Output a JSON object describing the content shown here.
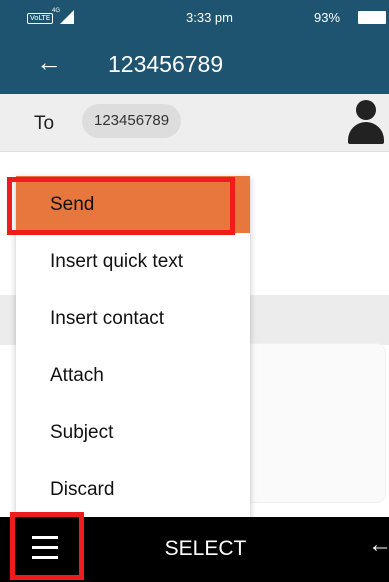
{
  "status_bar": {
    "volte": "VoLTE",
    "network": "4G",
    "time": "3:33 pm",
    "battery": "93%"
  },
  "header": {
    "back_icon": "arrow-left-icon",
    "title": "123456789"
  },
  "recipient": {
    "to_label": "To",
    "chip": "123456789",
    "avatar_icon": "person-icon"
  },
  "menu": {
    "items": [
      {
        "label": "Send",
        "selected": true
      },
      {
        "label": "Insert quick text",
        "selected": false
      },
      {
        "label": "Insert contact",
        "selected": false
      },
      {
        "label": "Attach",
        "selected": false
      },
      {
        "label": "Subject",
        "selected": false
      },
      {
        "label": "Discard",
        "selected": false
      }
    ]
  },
  "softkeys": {
    "left_icon": "hamburger-menu-icon",
    "center": "SELECT",
    "right_icon": "arrow-left-icon"
  },
  "colors": {
    "header": "#1e5470",
    "selected_item": "#e8773e",
    "highlight": "#ee1c1c"
  }
}
